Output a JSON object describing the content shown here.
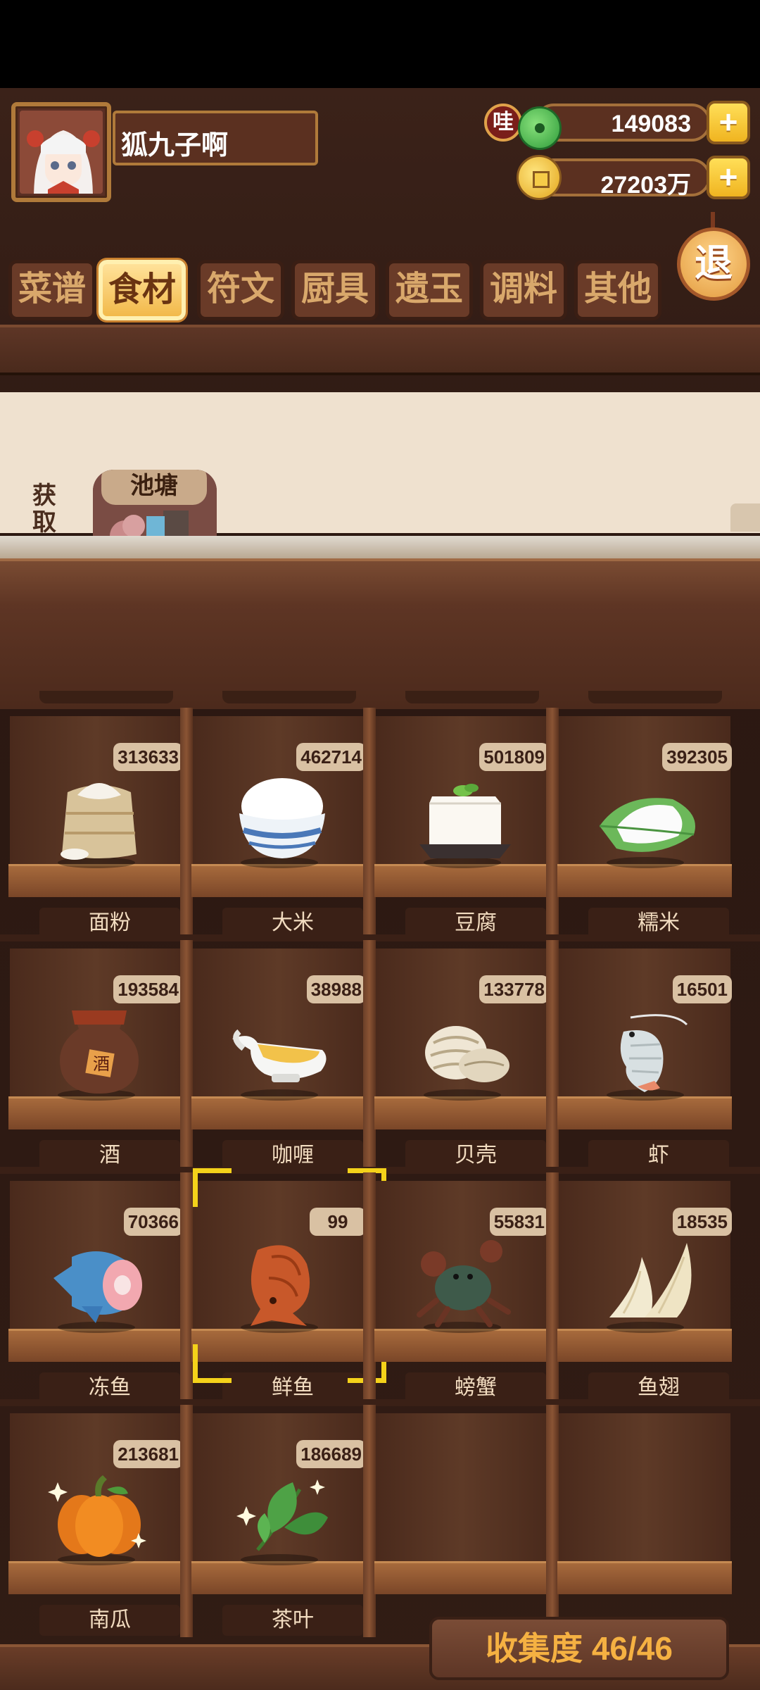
{
  "player": {
    "name": "狐九子啊"
  },
  "currency": {
    "jade_badge": "哇",
    "jade_value": "149083",
    "gold_value": "27203万",
    "plus": "+"
  },
  "exit_label": "退",
  "tabs": [
    {
      "label": "菜谱",
      "active": false
    },
    {
      "label": "食材",
      "active": true
    },
    {
      "label": "符文",
      "active": false
    },
    {
      "label": "厨具",
      "active": false
    },
    {
      "label": "遗玉",
      "active": false
    },
    {
      "label": "调料",
      "active": false
    },
    {
      "label": "其他",
      "active": false
    }
  ],
  "source": {
    "label": "获取途径",
    "card_title": "池塘",
    "card_sign": "池塘"
  },
  "items": [
    {
      "name": "面粉",
      "count": "313633",
      "icon": "flour-sack-icon",
      "color": "#e8d6b0"
    },
    {
      "name": "大米",
      "count": "462714",
      "icon": "rice-bowl-icon",
      "color": "#f6f6f6"
    },
    {
      "name": "豆腐",
      "count": "501809",
      "icon": "tofu-icon",
      "color": "#f4efe6"
    },
    {
      "name": "糯米",
      "count": "392305",
      "icon": "sticky-rice-leaf-icon",
      "color": "#7cc26a"
    },
    {
      "name": "酒",
      "count": "193584",
      "icon": "wine-jar-icon",
      "color": "#8a3a24"
    },
    {
      "name": "咖喱",
      "count": "38988",
      "icon": "curry-gravy-boat-icon",
      "color": "#f2c24a"
    },
    {
      "name": "贝壳",
      "count": "133778",
      "icon": "shell-icon",
      "color": "#e6dccb"
    },
    {
      "name": "虾",
      "count": "16501",
      "icon": "shrimp-icon",
      "color": "#d8e0e2"
    },
    {
      "name": "冻鱼",
      "count": "70366",
      "icon": "frozen-fish-icon",
      "color": "#4a8fc8"
    },
    {
      "name": "鲜鱼",
      "count": "99",
      "icon": "fresh-fish-icon",
      "color": "#d0602a"
    },
    {
      "name": "螃蟹",
      "count": "55831",
      "icon": "crab-icon",
      "color": "#3e5a4a"
    },
    {
      "name": "鱼翅",
      "count": "18535",
      "icon": "shark-fin-icon",
      "color": "#f2ead0"
    },
    {
      "name": "南瓜",
      "count": "213681",
      "icon": "pumpkin-icon",
      "color": "#f08a1c"
    },
    {
      "name": "茶叶",
      "count": "186689",
      "icon": "tea-leaf-icon",
      "color": "#4ea246"
    }
  ],
  "selected_item": "鲜鱼",
  "collection": {
    "label": "收集度 46/46"
  }
}
